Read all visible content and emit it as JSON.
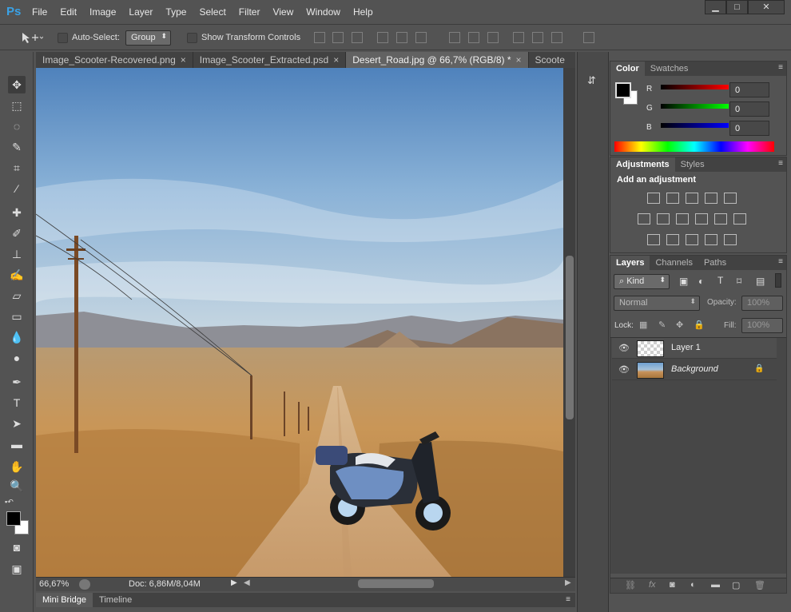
{
  "app": {
    "logo": "Ps"
  },
  "menu": [
    "File",
    "Edit",
    "Image",
    "Layer",
    "Type",
    "Select",
    "Filter",
    "View",
    "Window",
    "Help"
  ],
  "window_controls": {
    "minimize": "▁",
    "maximize": "□",
    "close": "✕"
  },
  "options": {
    "tool_icon": "move-icon",
    "auto_select_label": "Auto-Select:",
    "auto_select_value": "Group",
    "show_transform_label": "Show Transform Controls"
  },
  "tabs": [
    {
      "label": "Image_Scooter-Recovered.png",
      "active": false
    },
    {
      "label": "Image_Scooter_Extracted.psd",
      "active": false
    },
    {
      "label": "Desert_Road.jpg @ 66,7% (RGB/8) *",
      "active": true
    },
    {
      "label": "Scoote",
      "active": false
    }
  ],
  "tab_overflow": ">>",
  "status": {
    "zoom": "66,67%",
    "doc": "Doc: 6,86M/8,04M"
  },
  "bridge": {
    "tabs": [
      "Mini Bridge",
      "Timeline"
    ]
  },
  "color_panel": {
    "tabs": [
      "Color",
      "Swatches"
    ],
    "channels": [
      {
        "label": "R",
        "value": "0",
        "color": "#ff0000"
      },
      {
        "label": "G",
        "value": "0",
        "color": "#00ff00"
      },
      {
        "label": "B",
        "value": "0",
        "color": "#0000ff"
      }
    ]
  },
  "adjustments_panel": {
    "tabs": [
      "Adjustments",
      "Styles"
    ],
    "title": "Add an adjustment"
  },
  "layers_panel": {
    "tabs": [
      "Layers",
      "Channels",
      "Paths"
    ],
    "kind_label": "Kind",
    "blend_mode": "Normal",
    "opacity_label": "Opacity:",
    "opacity_value": "100%",
    "lock_label": "Lock:",
    "fill_label": "Fill:",
    "fill_value": "100%",
    "layers": [
      {
        "name": "Layer 1",
        "italic": false,
        "locked": false
      },
      {
        "name": "Background",
        "italic": true,
        "locked": true
      }
    ]
  },
  "colors": {
    "accent": "#3aa2e6",
    "sky": "#6f9fcf",
    "sand": "#c7925a"
  }
}
